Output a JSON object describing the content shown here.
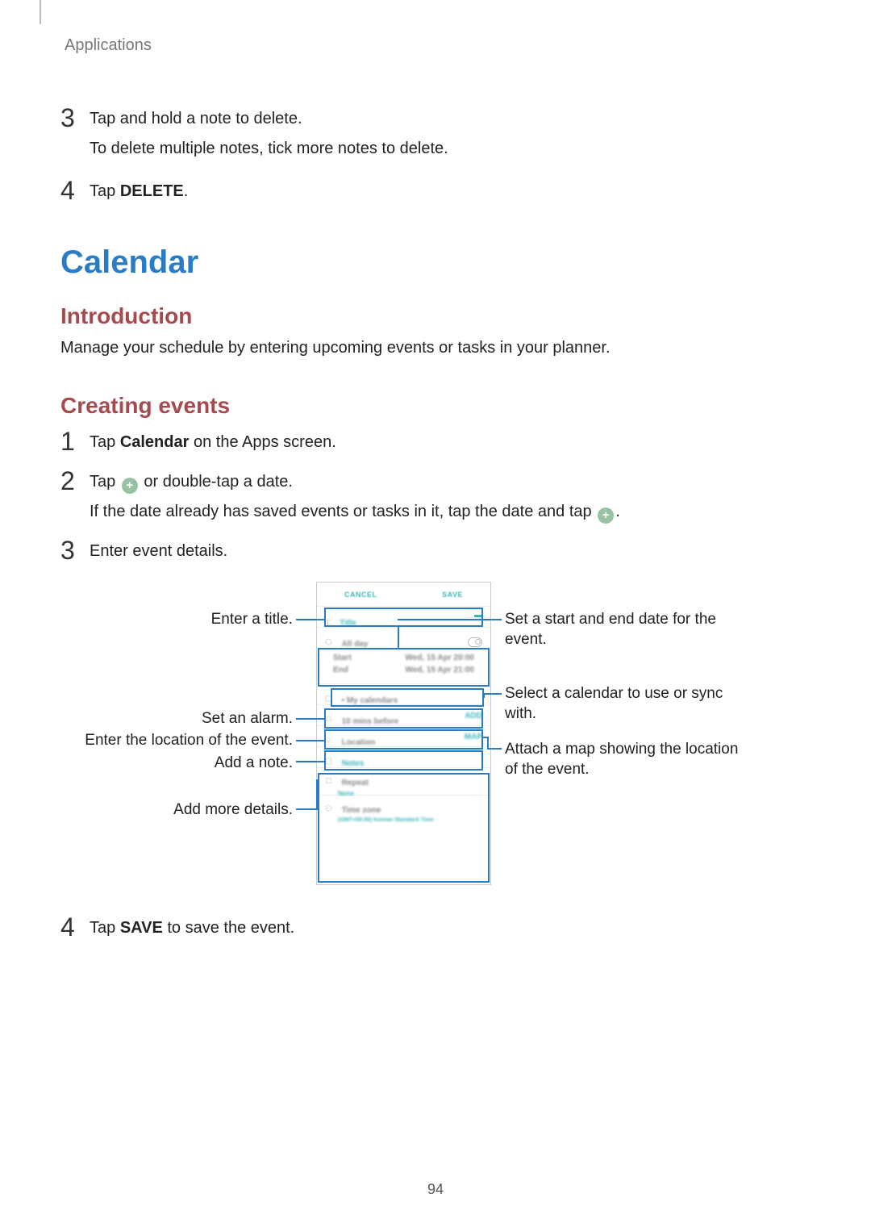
{
  "header": {
    "section": "Applications"
  },
  "prev_steps": {
    "s3": {
      "num": "3",
      "main": "Tap and hold a note to delete.",
      "sub": "To delete multiple notes, tick more notes to delete."
    },
    "s4": {
      "num": "4",
      "prefix": "Tap ",
      "bold": "DELETE",
      "suffix": "."
    }
  },
  "title": "Calendar",
  "intro": {
    "heading": "Introduction",
    "text": "Manage your schedule by entering upcoming events or tasks in your planner."
  },
  "creating": {
    "heading": "Creating events",
    "s1": {
      "num": "1",
      "prefix": "Tap ",
      "bold": "Calendar",
      "suffix": " on the Apps screen."
    },
    "s2": {
      "num": "2",
      "prefix": "Tap ",
      "mid": " or double-tap a date.",
      "sub_prefix": "If the date already has saved events or tasks in it, tap the date and tap ",
      "sub_suffix": "."
    },
    "s3": {
      "num": "3",
      "text": "Enter event details."
    },
    "s4": {
      "num": "4",
      "prefix": "Tap ",
      "bold": "SAVE",
      "suffix": " to save the event."
    }
  },
  "phone_ui": {
    "cancel": "CANCEL",
    "save": "SAVE",
    "title_label": "Title",
    "allday": "All day",
    "start": "Start",
    "end": "End",
    "date1": "Wed, 15 Apr   20:00",
    "date2": "Wed, 15 Apr   21:00",
    "my_cal": "• My calendars",
    "alarm": "10 mins before",
    "alarm_add": "ADD",
    "loc": "Location",
    "loc_map": "MAP",
    "notes": "Notes",
    "repeat": "Repeat",
    "repeat_val": "None",
    "timezone": "Time zone",
    "timezone_val": "(GMT+09:00) Korean Standard Time"
  },
  "callouts": {
    "title": "Enter a title.",
    "alarm": "Set an alarm.",
    "location": "Enter the location of the event.",
    "note": "Add a note.",
    "more": "Add more details.",
    "dates": "Set a start and end date for the event.",
    "calendar": "Select a calendar to use or sync with.",
    "map": "Attach a map showing the location of the event."
  },
  "page_number": "94"
}
